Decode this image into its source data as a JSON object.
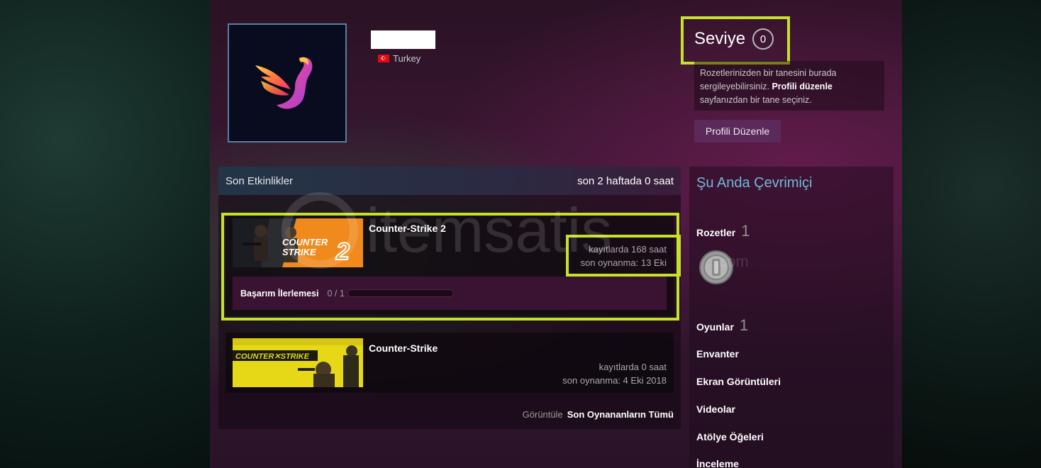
{
  "profile": {
    "country": "Turkey",
    "level_label": "Seviye",
    "level_value": "0"
  },
  "badge_note": {
    "before": "Rozetlerinizden bir tanesini burada sergileyebilirsiniz. ",
    "link": "Profili düzenle",
    "after": " sayfanızdan bir tane seçiniz."
  },
  "edit_profile_button": "Profili Düzenle",
  "activity": {
    "title": "Son Etkinlikler",
    "summary": "son 2 haftada 0 saat",
    "games": [
      {
        "name": "Counter-Strike 2",
        "capsule_text": "COUNTER STRIKE 2",
        "hours": "kayıtlarda 168 saat",
        "last_played": "son oynanma: 13 Eki",
        "achievement_label": "Başarım İlerlemesi",
        "achievement_count": "0 / 1",
        "achievement_fraction": 0
      },
      {
        "name": "Counter-Strike",
        "capsule_text": "COUNTER-STRIKE",
        "hours": "kayıtlarda 0 saat",
        "last_played": "son oynanma: 4 Eki 2018"
      }
    ],
    "view_label": "Görüntüle",
    "view_all": "Son Oynananların Tümü"
  },
  "right_column": {
    "online_status": "Şu Anda Çevrimiçi",
    "badges_label": "Rozetler",
    "badges_count": "1",
    "games_label": "Oyunlar",
    "games_count": "1",
    "links": [
      "Envanter",
      "Ekran Görüntüleri",
      "Videolar",
      "Atölye Öğeleri",
      "İnceleme"
    ]
  },
  "watermark": {
    "text": "itemsatis",
    "suffix": ".com"
  },
  "colors": {
    "highlight": "#c6e12b",
    "online": "#6fbad8",
    "edit_button": "#5b2a5a",
    "flag": "#e30a17"
  },
  "icons": [
    "swan-logo-icon",
    "turkey-flag-icon",
    "level-badge-icon",
    "badge-coin-icon"
  ]
}
